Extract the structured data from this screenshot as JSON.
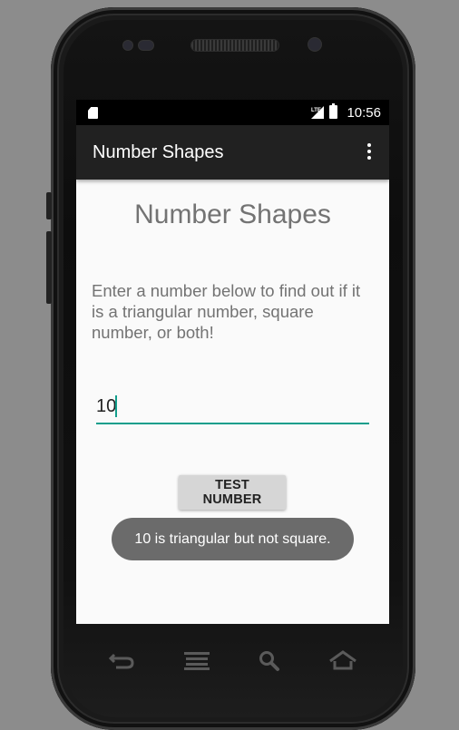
{
  "status_bar": {
    "time": "10:56",
    "icons": [
      "sd-card-icon",
      "lte-signal-icon",
      "battery-icon"
    ]
  },
  "app_bar": {
    "title": "Number Shapes",
    "menu_icon": "overflow-menu-icon"
  },
  "main": {
    "heading": "Number Shapes",
    "description": "Enter a number below to find out if it is a triangular number, square number, or both!",
    "number_input": {
      "value": "10",
      "placeholder": ""
    },
    "test_button_label": "TEST NUMBER"
  },
  "toast": {
    "message": "10 is triangular but not square."
  },
  "nav_bar": {
    "icons": [
      "back-icon",
      "menu-icon",
      "search-icon",
      "home-icon"
    ]
  },
  "colors": {
    "accent": "#139e8c",
    "app_bar": "#212121",
    "background": "#fafafa",
    "toast": "#6b6b6b"
  }
}
